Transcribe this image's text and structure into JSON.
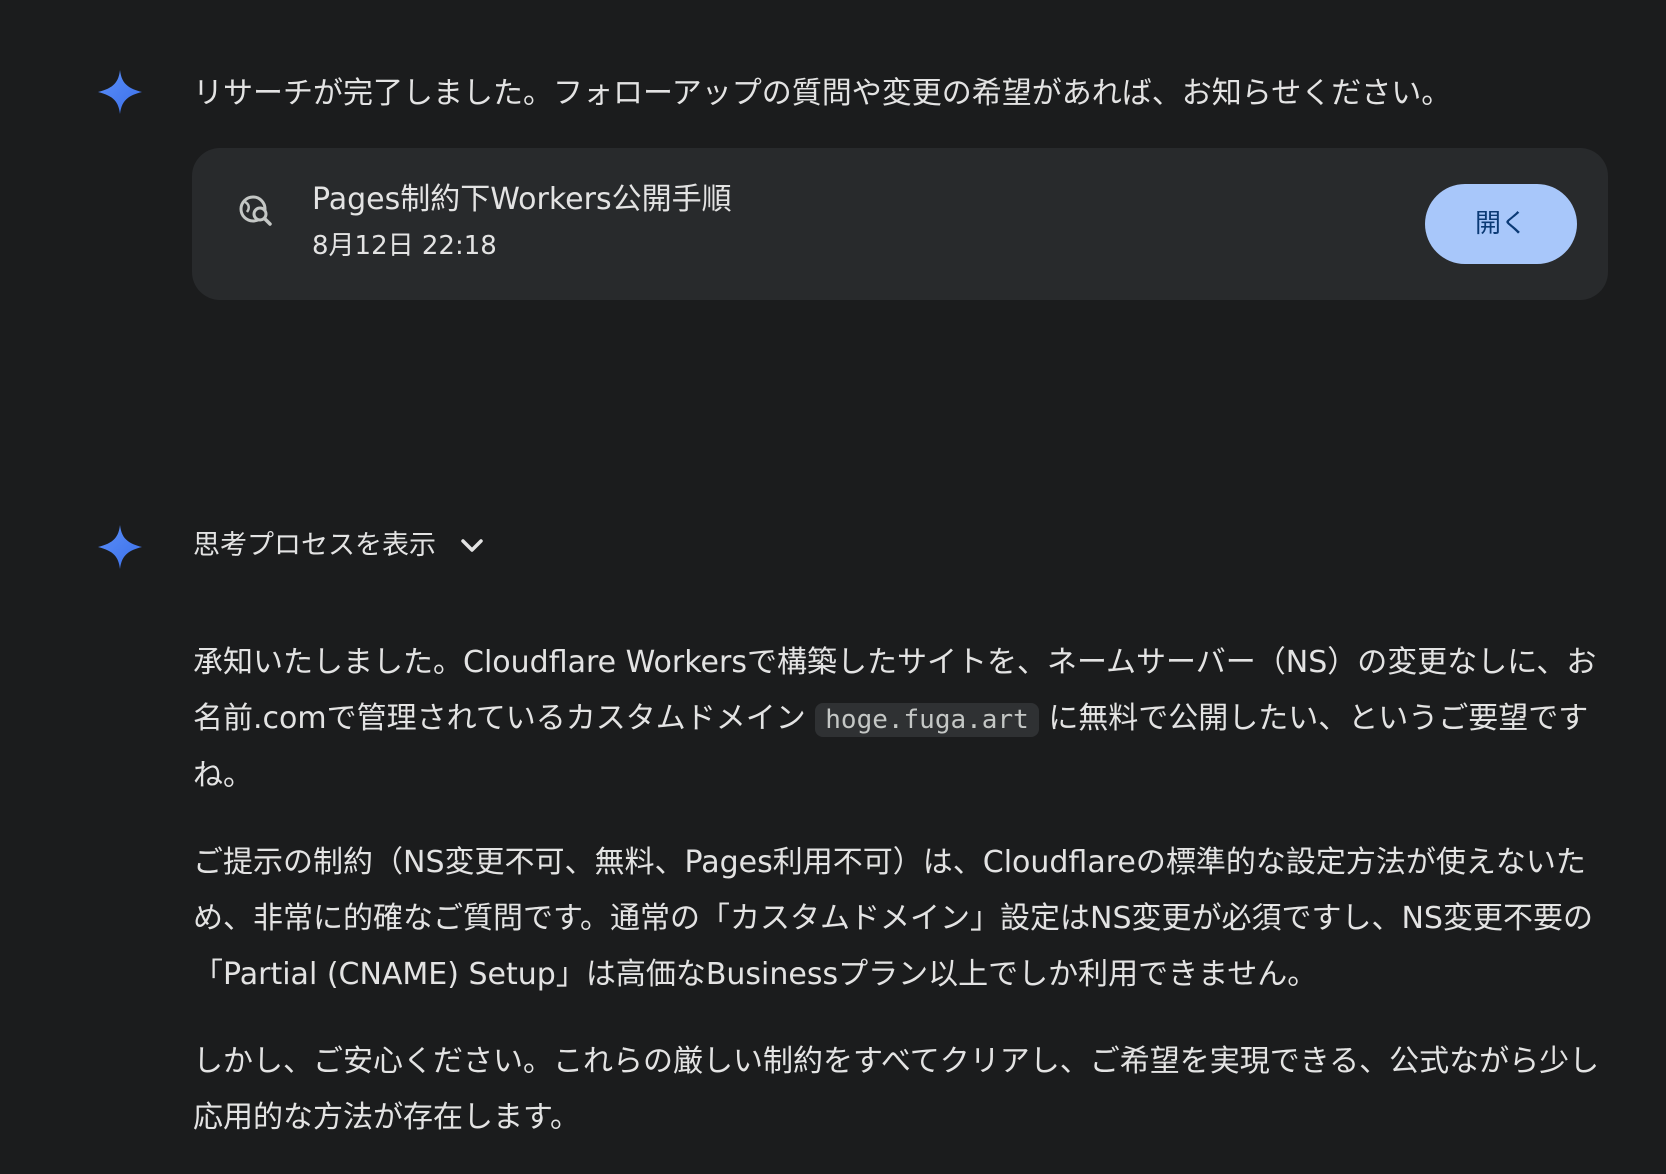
{
  "message1": {
    "icon": "gemini-sparkle-icon",
    "text": "リサーチが完了しました。フォローアップの質問や変更の希望があれば、お知らせください。"
  },
  "research_card": {
    "icon": "research-globe-search-icon",
    "title": "Pages制約下Workers公開手順",
    "date": "8月12日 22:18",
    "open_label": "開く"
  },
  "message2": {
    "icon": "gemini-sparkle-icon",
    "thinking_label": "思考プロセスを表示",
    "thinking_icon": "chevron-down-icon",
    "p1_a": "承知いたしました。Cloudflare Workersで構築したサイトを、ネームサーバー（NS）の変更なしに、お名前.comで管理されているカスタムドメイン",
    "p1_code": "hoge.fuga.art",
    "p1_b": "に無料で公開したい、というご要望ですね。",
    "p2": "ご提示の制約（NS変更不可、無料、Pages利用不可）は、Cloudflareの標準的な設定方法が使えないため、非常に的確なご質問です。通常の「カスタムドメイン」設定はNS変更が必須ですし、NS変更不要の「Partial (CNAME) Setup」は高価なBusinessプラン以上でしか利用できません。",
    "p3": "しかし、ご安心ください。これらの厳しい制約をすべてクリアし、ご希望を実現できる、公式ながら少し応用的な方法が存在します。"
  },
  "colors": {
    "background": "#1b1c1d",
    "card": "#282a2c",
    "button": "#a8c7fa",
    "sparkle": "#4a86f0"
  }
}
